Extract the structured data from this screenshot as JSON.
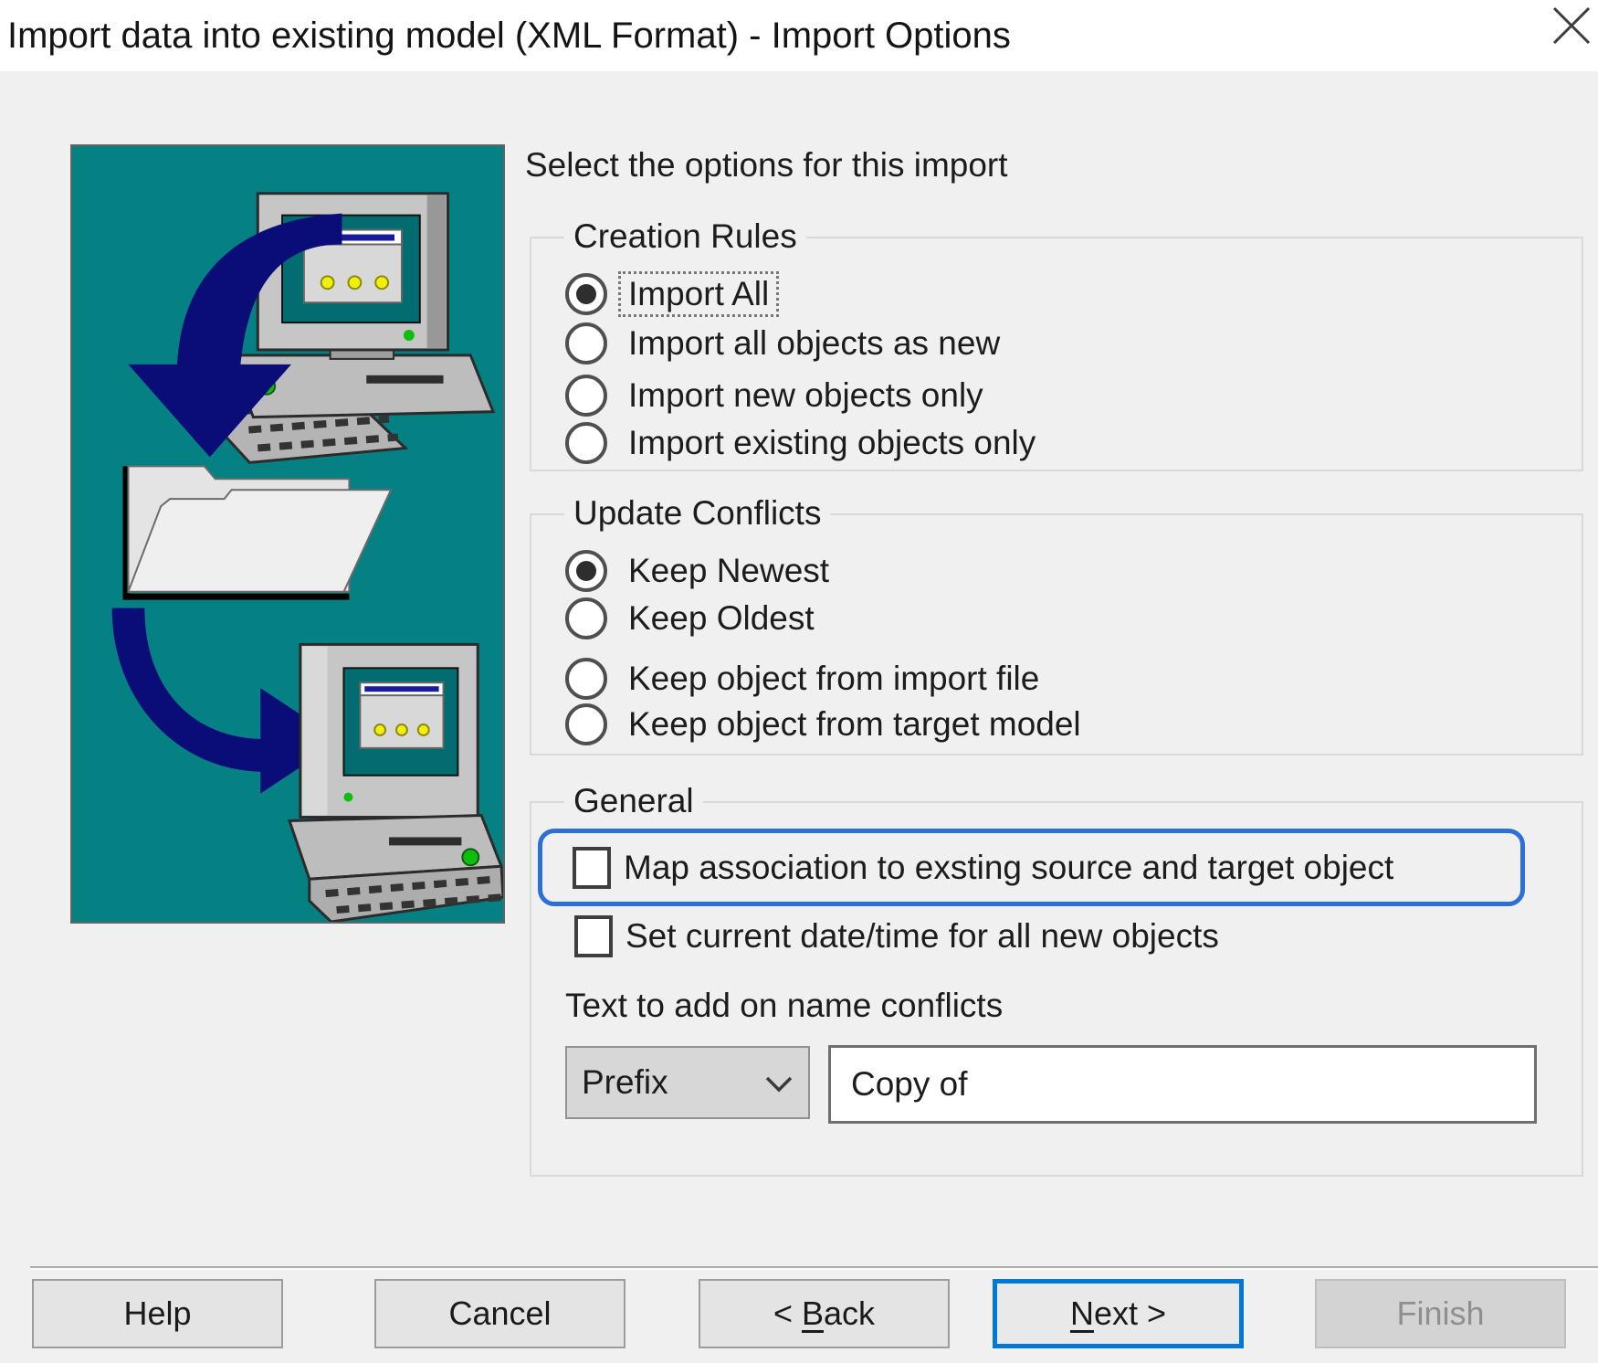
{
  "window": {
    "title": "Import data into existing model (XML Format) - Import Options",
    "close_icon": "close-x"
  },
  "intro_text": "Select the options for this import",
  "creation_rules": {
    "legend": "Creation Rules",
    "options": [
      {
        "label": "Import All",
        "selected": true,
        "focused": true
      },
      {
        "label": "Import all objects as new",
        "selected": false,
        "focused": false
      },
      {
        "label": "Import new objects only",
        "selected": false,
        "focused": false
      },
      {
        "label": "Import existing objects only",
        "selected": false,
        "focused": false
      }
    ]
  },
  "update_conflicts": {
    "legend": "Update Conflicts",
    "options": [
      {
        "label": "Keep Newest",
        "selected": true
      },
      {
        "label": "Keep Oldest",
        "selected": false
      },
      {
        "label": "Keep object from import file",
        "selected": false
      },
      {
        "label": "Keep object from target model",
        "selected": false
      }
    ]
  },
  "general": {
    "legend": "General",
    "checkboxes": [
      {
        "label": "Map association to exsting source and target object",
        "checked": false,
        "highlighted": true
      },
      {
        "label": "Set current date/time for all new objects",
        "checked": false,
        "highlighted": false
      }
    ],
    "conflict_text_label": "Text to add on name conflicts",
    "affix_select": {
      "value": "Prefix"
    },
    "conflict_text_input": {
      "value": "Copy of"
    }
  },
  "buttons": {
    "help": {
      "label": "Help"
    },
    "cancel": {
      "label": "Cancel"
    },
    "back": {
      "prefix": "< ",
      "mnemonic": "B",
      "suffix": "ack"
    },
    "next": {
      "mnemonic": "N",
      "suffix": "ext >",
      "focused": true
    },
    "finish": {
      "label": "Finish",
      "disabled": true
    }
  },
  "graphic": {
    "description": "computer-to-folder-to-computer import illustration",
    "colors": {
      "teal_bg": "#058184",
      "arrow_navy": "#0a0d78"
    }
  },
  "colors": {
    "dialog_bg": "#f0f0f0",
    "titlebar_bg": "#ffffff",
    "highlight_blue": "#2e6fd6",
    "focus_blue": "#0078d7",
    "group_border": "#d9d9d9",
    "text": "#1c1c1c"
  }
}
